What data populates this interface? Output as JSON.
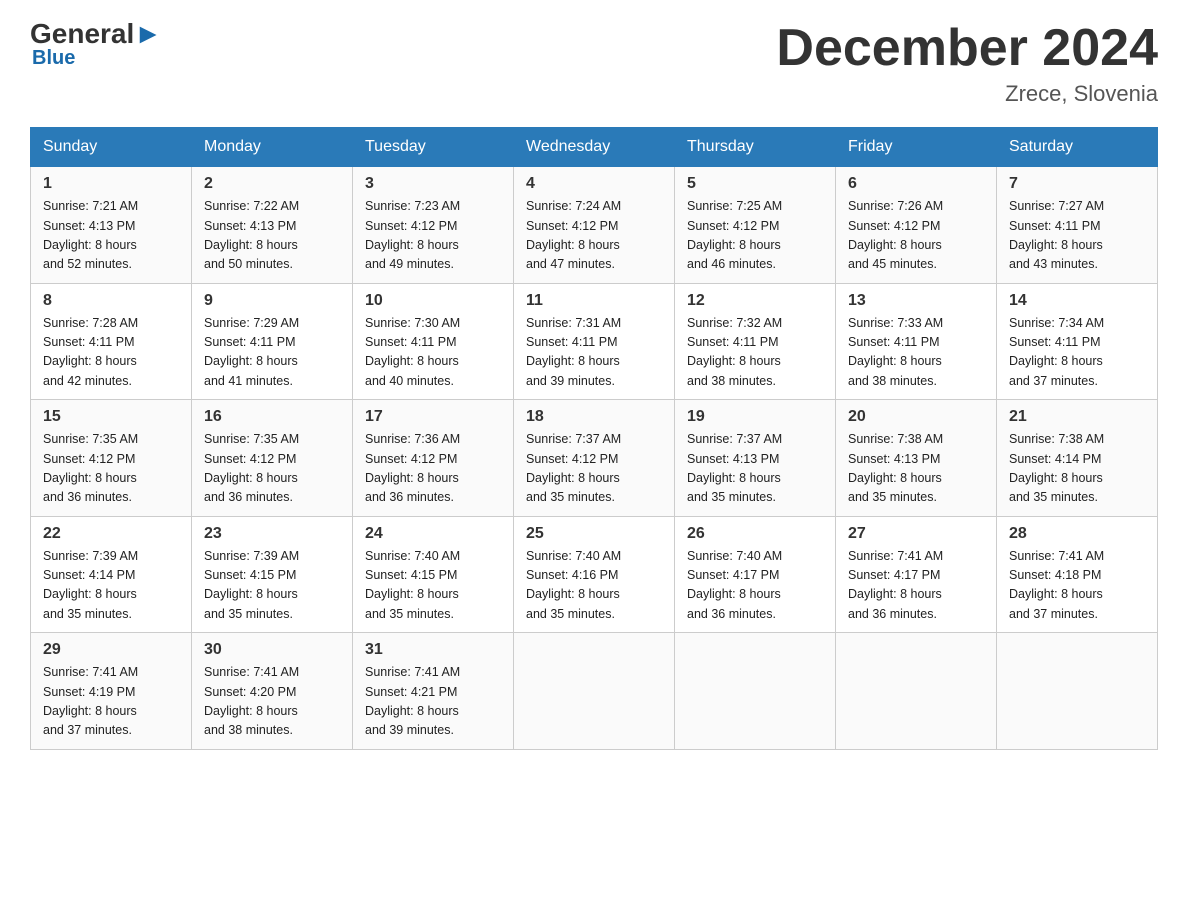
{
  "header": {
    "logo": {
      "general": "General",
      "blue": "Blue"
    },
    "title": "December 2024",
    "location": "Zrece, Slovenia"
  },
  "calendar": {
    "days_of_week": [
      "Sunday",
      "Monday",
      "Tuesday",
      "Wednesday",
      "Thursday",
      "Friday",
      "Saturday"
    ],
    "weeks": [
      [
        {
          "day": 1,
          "sunrise": "7:21 AM",
          "sunset": "4:13 PM",
          "daylight": "8 hours and 52 minutes."
        },
        {
          "day": 2,
          "sunrise": "7:22 AM",
          "sunset": "4:13 PM",
          "daylight": "8 hours and 50 minutes."
        },
        {
          "day": 3,
          "sunrise": "7:23 AM",
          "sunset": "4:12 PM",
          "daylight": "8 hours and 49 minutes."
        },
        {
          "day": 4,
          "sunrise": "7:24 AM",
          "sunset": "4:12 PM",
          "daylight": "8 hours and 47 minutes."
        },
        {
          "day": 5,
          "sunrise": "7:25 AM",
          "sunset": "4:12 PM",
          "daylight": "8 hours and 46 minutes."
        },
        {
          "day": 6,
          "sunrise": "7:26 AM",
          "sunset": "4:12 PM",
          "daylight": "8 hours and 45 minutes."
        },
        {
          "day": 7,
          "sunrise": "7:27 AM",
          "sunset": "4:11 PM",
          "daylight": "8 hours and 43 minutes."
        }
      ],
      [
        {
          "day": 8,
          "sunrise": "7:28 AM",
          "sunset": "4:11 PM",
          "daylight": "8 hours and 42 minutes."
        },
        {
          "day": 9,
          "sunrise": "7:29 AM",
          "sunset": "4:11 PM",
          "daylight": "8 hours and 41 minutes."
        },
        {
          "day": 10,
          "sunrise": "7:30 AM",
          "sunset": "4:11 PM",
          "daylight": "8 hours and 40 minutes."
        },
        {
          "day": 11,
          "sunrise": "7:31 AM",
          "sunset": "4:11 PM",
          "daylight": "8 hours and 39 minutes."
        },
        {
          "day": 12,
          "sunrise": "7:32 AM",
          "sunset": "4:11 PM",
          "daylight": "8 hours and 38 minutes."
        },
        {
          "day": 13,
          "sunrise": "7:33 AM",
          "sunset": "4:11 PM",
          "daylight": "8 hours and 38 minutes."
        },
        {
          "day": 14,
          "sunrise": "7:34 AM",
          "sunset": "4:11 PM",
          "daylight": "8 hours and 37 minutes."
        }
      ],
      [
        {
          "day": 15,
          "sunrise": "7:35 AM",
          "sunset": "4:12 PM",
          "daylight": "8 hours and 36 minutes."
        },
        {
          "day": 16,
          "sunrise": "7:35 AM",
          "sunset": "4:12 PM",
          "daylight": "8 hours and 36 minutes."
        },
        {
          "day": 17,
          "sunrise": "7:36 AM",
          "sunset": "4:12 PM",
          "daylight": "8 hours and 36 minutes."
        },
        {
          "day": 18,
          "sunrise": "7:37 AM",
          "sunset": "4:12 PM",
          "daylight": "8 hours and 35 minutes."
        },
        {
          "day": 19,
          "sunrise": "7:37 AM",
          "sunset": "4:13 PM",
          "daylight": "8 hours and 35 minutes."
        },
        {
          "day": 20,
          "sunrise": "7:38 AM",
          "sunset": "4:13 PM",
          "daylight": "8 hours and 35 minutes."
        },
        {
          "day": 21,
          "sunrise": "7:38 AM",
          "sunset": "4:14 PM",
          "daylight": "8 hours and 35 minutes."
        }
      ],
      [
        {
          "day": 22,
          "sunrise": "7:39 AM",
          "sunset": "4:14 PM",
          "daylight": "8 hours and 35 minutes."
        },
        {
          "day": 23,
          "sunrise": "7:39 AM",
          "sunset": "4:15 PM",
          "daylight": "8 hours and 35 minutes."
        },
        {
          "day": 24,
          "sunrise": "7:40 AM",
          "sunset": "4:15 PM",
          "daylight": "8 hours and 35 minutes."
        },
        {
          "day": 25,
          "sunrise": "7:40 AM",
          "sunset": "4:16 PM",
          "daylight": "8 hours and 35 minutes."
        },
        {
          "day": 26,
          "sunrise": "7:40 AM",
          "sunset": "4:17 PM",
          "daylight": "8 hours and 36 minutes."
        },
        {
          "day": 27,
          "sunrise": "7:41 AM",
          "sunset": "4:17 PM",
          "daylight": "8 hours and 36 minutes."
        },
        {
          "day": 28,
          "sunrise": "7:41 AM",
          "sunset": "4:18 PM",
          "daylight": "8 hours and 37 minutes."
        }
      ],
      [
        {
          "day": 29,
          "sunrise": "7:41 AM",
          "sunset": "4:19 PM",
          "daylight": "8 hours and 37 minutes."
        },
        {
          "day": 30,
          "sunrise": "7:41 AM",
          "sunset": "4:20 PM",
          "daylight": "8 hours and 38 minutes."
        },
        {
          "day": 31,
          "sunrise": "7:41 AM",
          "sunset": "4:21 PM",
          "daylight": "8 hours and 39 minutes."
        },
        null,
        null,
        null,
        null
      ]
    ]
  }
}
